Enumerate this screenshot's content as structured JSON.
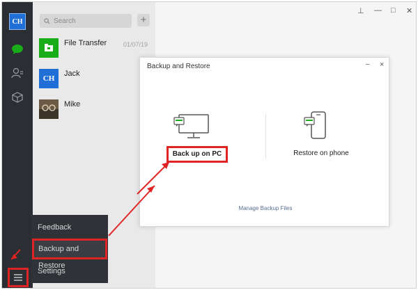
{
  "rail": {
    "avatar_text": "CH",
    "icons": [
      "chat-icon",
      "contacts-icon",
      "box-icon"
    ],
    "menu_icon": "hamburger-menu-icon"
  },
  "list": {
    "search_placeholder": "Search",
    "add_label": "+",
    "chats": [
      {
        "name": "File Transfer",
        "time": "01/07/19",
        "avatar": "folder-icon"
      },
      {
        "name": "Jack",
        "time": "",
        "avatar": "CH"
      },
      {
        "name": "Mike",
        "time": "",
        "avatar": "photo"
      }
    ]
  },
  "window": {
    "pin": "⊥",
    "minimize": "—",
    "maximize": "□",
    "close": "✕"
  },
  "popup_menu": {
    "items": [
      "Feedback",
      "Backup and Restore",
      "Settings"
    ]
  },
  "dialog": {
    "title": "Backup and Restore",
    "minimize": "–",
    "close": "×",
    "backup_label": "Back up on PC",
    "restore_label": "Restore on phone",
    "manage_label": "Manage Backup Files"
  },
  "colors": {
    "highlight": "#e02424",
    "brand_green": "#19ad19",
    "rail": "#2b2e33"
  }
}
